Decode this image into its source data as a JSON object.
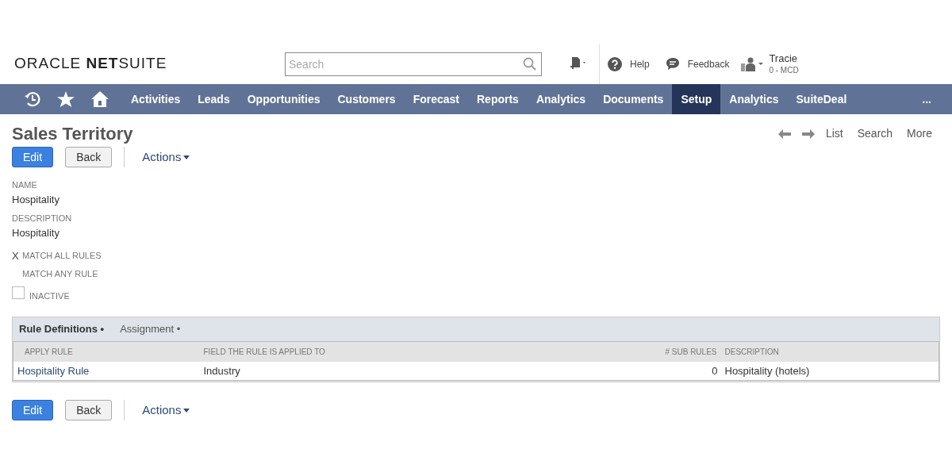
{
  "header": {
    "logo": {
      "light": "ORACLE",
      "bold": "NET",
      "rest": "SUITE"
    },
    "search": {
      "placeholder": "Search"
    },
    "help": "Help",
    "feedback": "Feedback",
    "user": {
      "name": "Tracie",
      "role": "0 - MCD"
    }
  },
  "nav": {
    "items": [
      {
        "label": "Activities",
        "selected": false
      },
      {
        "label": "Leads",
        "selected": false
      },
      {
        "label": "Opportunities",
        "selected": false
      },
      {
        "label": "Customers",
        "selected": false
      },
      {
        "label": "Forecast",
        "selected": false
      },
      {
        "label": "Reports",
        "selected": false
      },
      {
        "label": "Analytics",
        "selected": false
      },
      {
        "label": "Documents",
        "selected": false
      },
      {
        "label": "Setup",
        "selected": true
      },
      {
        "label": "Analytics",
        "selected": false
      },
      {
        "label": "SuiteDeal",
        "selected": false
      }
    ],
    "more": "..."
  },
  "page": {
    "title": "Sales Territory",
    "links": [
      "List",
      "Search",
      "More"
    ],
    "buttons": {
      "edit": "Edit",
      "back": "Back",
      "actions": "Actions"
    },
    "fields": [
      {
        "label": "NAME",
        "value": "Hospitality"
      },
      {
        "label": "DESCRIPTION",
        "value": "Hospitality"
      }
    ],
    "match_marker": "X",
    "match_options": [
      {
        "label": "MATCH ALL RULES",
        "selected": true
      },
      {
        "label": "MATCH ANY RULE",
        "selected": false
      }
    ],
    "inactive": {
      "label": "INACTIVE",
      "checked": false
    }
  },
  "subtabs": [
    {
      "label": "Rule Definitions •",
      "selected": true
    },
    {
      "label": "Assignment •",
      "selected": false
    }
  ],
  "table": {
    "columns": [
      "APPLY RULE",
      "FIELD THE RULE IS APPLIED TO",
      "# SUB RULES",
      "DESCRIPTION"
    ],
    "rows": [
      [
        "Hospitality Rule",
        "Industry",
        "0",
        "Hospitality (hotels)"
      ]
    ]
  },
  "bottom_buttons": {
    "edit": "Edit",
    "back": "Back",
    "actions": "Actions"
  }
}
